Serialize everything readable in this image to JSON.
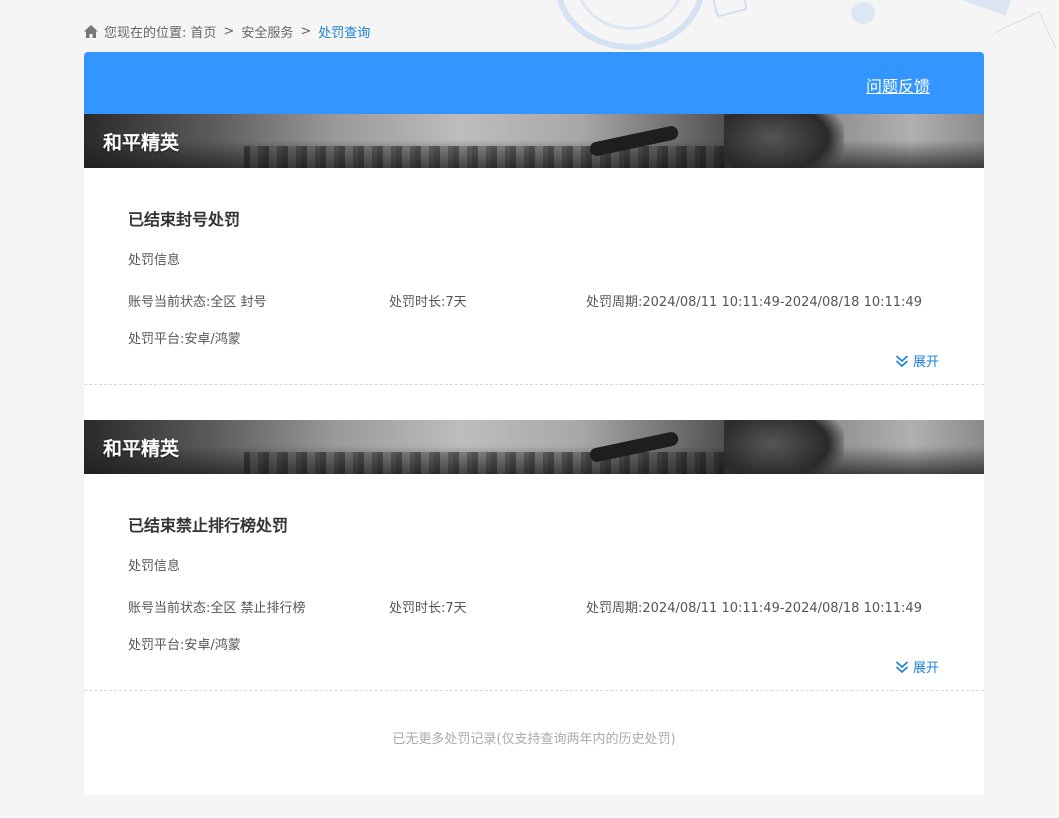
{
  "breadcrumb": {
    "prefix": "您现在的位置:",
    "items": [
      "首页",
      "安全服务"
    ],
    "current": "处罚查询",
    "separator": ">"
  },
  "header": {
    "feedback_label": "问题反馈",
    "accent_color": "#3395ff"
  },
  "records": [
    {
      "game": "和平精英",
      "title": "已结束封号处罚",
      "section_label": "处罚信息",
      "status_label": "账号当前状态:",
      "status_value": "全区 封号",
      "duration_label": "处罚时长:",
      "duration_value": "7天",
      "period_label": "处罚周期:",
      "period_value": "2024/08/11 10:11:49-2024/08/18 10:11:49",
      "platform_label": "处罚平台:",
      "platform_value": "安卓/鸿蒙",
      "expand_label": "展开"
    },
    {
      "game": "和平精英",
      "title": "已结束禁止排行榜处罚",
      "section_label": "处罚信息",
      "status_label": "账号当前状态:",
      "status_value": "全区 禁止排行榜",
      "duration_label": "处罚时长:",
      "duration_value": "7天",
      "period_label": "处罚周期:",
      "period_value": "2024/08/11 10:11:49-2024/08/18 10:11:49",
      "platform_label": "处罚平台:",
      "platform_value": "安卓/鸿蒙",
      "expand_label": "展开"
    }
  ],
  "footer_note": "已无更多处罚记录(仅支持查询两年内的历史处罚)",
  "icons": {
    "breadcrumb": "home-icon",
    "expand": "chevron-double-down-icon"
  }
}
